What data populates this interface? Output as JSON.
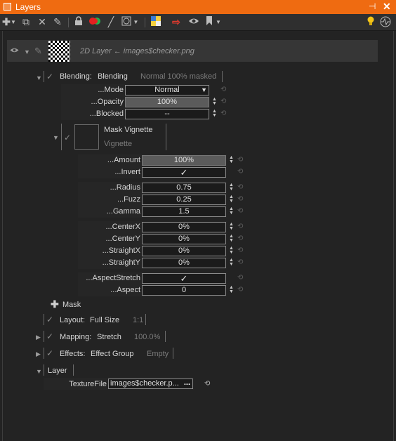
{
  "window": {
    "title": "Layers",
    "pin_glyph": "⊣",
    "close_glyph": "✕"
  },
  "toolbar": {
    "icons": [
      "add-icon",
      "copy-icon",
      "delete-icon",
      "brush-icon",
      "lock-icon",
      "color-icon",
      "pen-icon",
      "shape-icon",
      "image-icon",
      "arrow-icon",
      "eye-icon",
      "bookmark-icon",
      "lightbulb-icon",
      "activity-icon"
    ]
  },
  "layer": {
    "name": "2D Layer ← images$checker.png"
  },
  "blending": {
    "label": "Blending:",
    "value": "Blending",
    "summary": "Normal 100% masked",
    "params": {
      "mode_label": "...Mode",
      "mode_value": "Normal",
      "opacity_label": "...Opacity",
      "opacity_value": "100%",
      "blocked_label": "...Blocked",
      "blocked_value": "--"
    }
  },
  "mask": {
    "title": "Mask Vignette",
    "subtitle": "Vignette",
    "params": {
      "amount_label": "...Amount",
      "amount_value": "100%",
      "invert_label": "...Invert",
      "invert_value": "✓",
      "radius_label": "...Radius",
      "radius_value": "0.75",
      "fuzz_label": "...Fuzz",
      "fuzz_value": "0.25",
      "gamma_label": "...Gamma",
      "gamma_value": "1.5",
      "centerx_label": "...CenterX",
      "centerx_value": "0%",
      "centery_label": "...CenterY",
      "centery_value": "0%",
      "straightx_label": "...StraightX",
      "straightx_value": "0%",
      "straighty_label": "...StraightY",
      "straighty_value": "0%",
      "aspectstretch_label": "...AspectStretch",
      "aspectstretch_value": "✓",
      "aspect_label": "...Aspect",
      "aspect_value": "0"
    },
    "add_label": "Mask"
  },
  "layout": {
    "label": "Layout:",
    "value": "Full Size",
    "summary": "1:1"
  },
  "mapping": {
    "label": "Mapping:",
    "value": "Stretch",
    "summary": "100.0%"
  },
  "effects": {
    "label": "Effects:",
    "value": "Effect Group",
    "summary": "Empty"
  },
  "layer_section": {
    "label": "Layer",
    "texture_label": "TextureFile",
    "texture_value": "images$checker.p...",
    "texture_button": "..."
  },
  "colors": {
    "titlebar": "#ef6b11",
    "background": "#232323"
  }
}
